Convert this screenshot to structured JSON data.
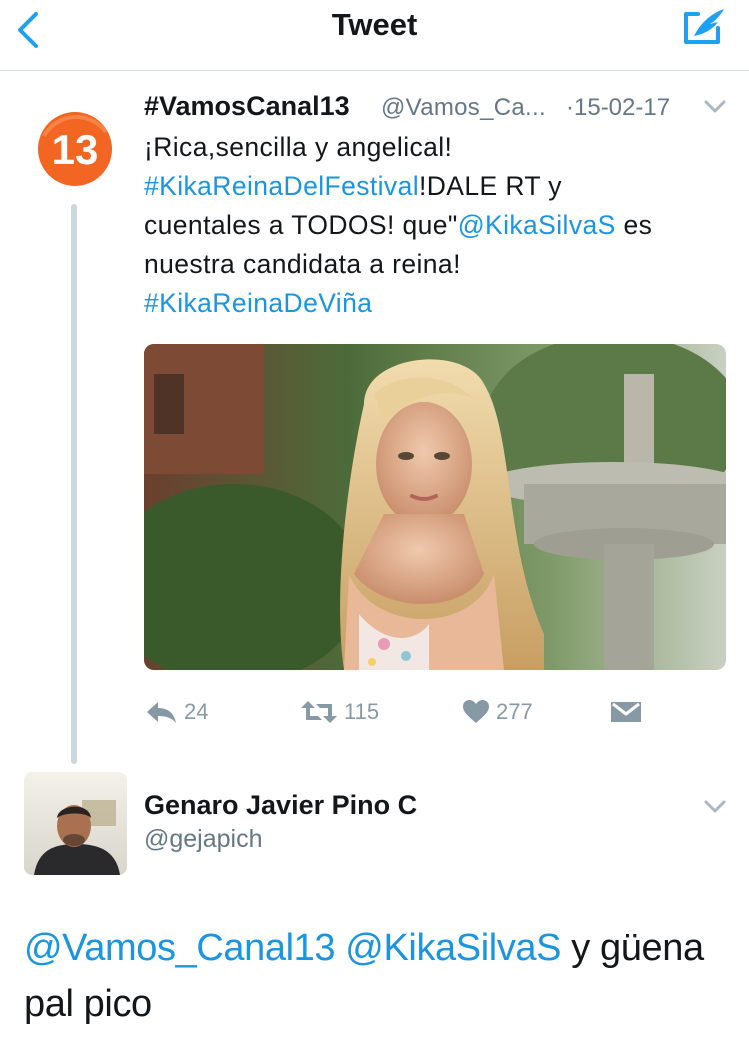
{
  "nav": {
    "title": "Tweet",
    "back_icon": "chevron-left-icon",
    "compose_icon": "compose-icon"
  },
  "tweet": {
    "display_name": "#VamosCanal13",
    "handle": "@Vamos_Ca...",
    "date": "·15-02-17",
    "avatar_label": "13",
    "text_lines": [
      [
        {
          "t": "¡Rica,sencilla y angelical!",
          "link": false
        }
      ],
      [
        {
          "t": "#KikaReinaDelFestival",
          "link": true
        },
        {
          "t": "!DALE RT y",
          "link": false
        }
      ],
      [
        {
          "t": "cuentales a TODOS! que\"",
          "link": false
        },
        {
          "t": "@KikaSilvaS",
          "link": true
        },
        {
          "t": " es",
          "link": false
        }
      ],
      [
        {
          "t": "nuestra candidata a reina!",
          "link": false
        }
      ],
      [
        {
          "t": "#KikaReinaDeViña",
          "link": true
        }
      ]
    ],
    "actions": {
      "reply_count": "24",
      "retweet_count": "115",
      "like_count": "277"
    }
  },
  "reply": {
    "display_name": "Genaro Javier Pino C",
    "handle": "@gejapich",
    "text_segments": [
      {
        "t": "@Vamos_Canal13",
        "link": true
      },
      {
        "t": " ",
        "link": false
      },
      {
        "t": "@KikaSilvaS",
        "link": true
      },
      {
        "t": " y güena pal pico",
        "link": false
      }
    ]
  },
  "colors": {
    "link": "#1b95e0",
    "secondary": "#657786",
    "icon": "#8899a6",
    "brand_orange": "#f26522"
  }
}
